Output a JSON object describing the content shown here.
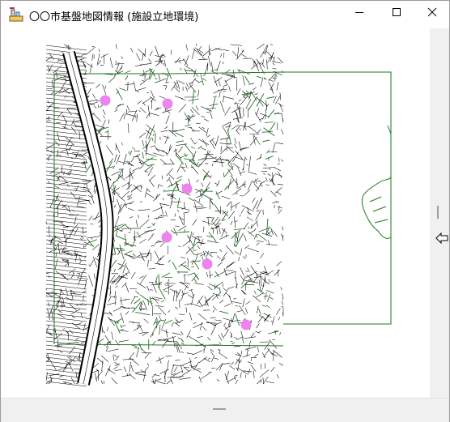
{
  "window": {
    "title": "〇〇市基盤地図情報 (施設立地環境)"
  },
  "icons": {
    "app": "app-map-icon",
    "minimize": "minimize-icon",
    "maximize": "maximize-icon",
    "close": "close-icon",
    "pan_arrow": "left-arrow-icon"
  },
  "colors": {
    "boundary": "#1a7a1a",
    "road": "#000000",
    "facility_marker": "#ee82ee",
    "background": "#ffffff"
  },
  "facilities": [
    "facility-1",
    "facility-2",
    "facility-3",
    "facility-4",
    "facility-5",
    "facility-6"
  ]
}
